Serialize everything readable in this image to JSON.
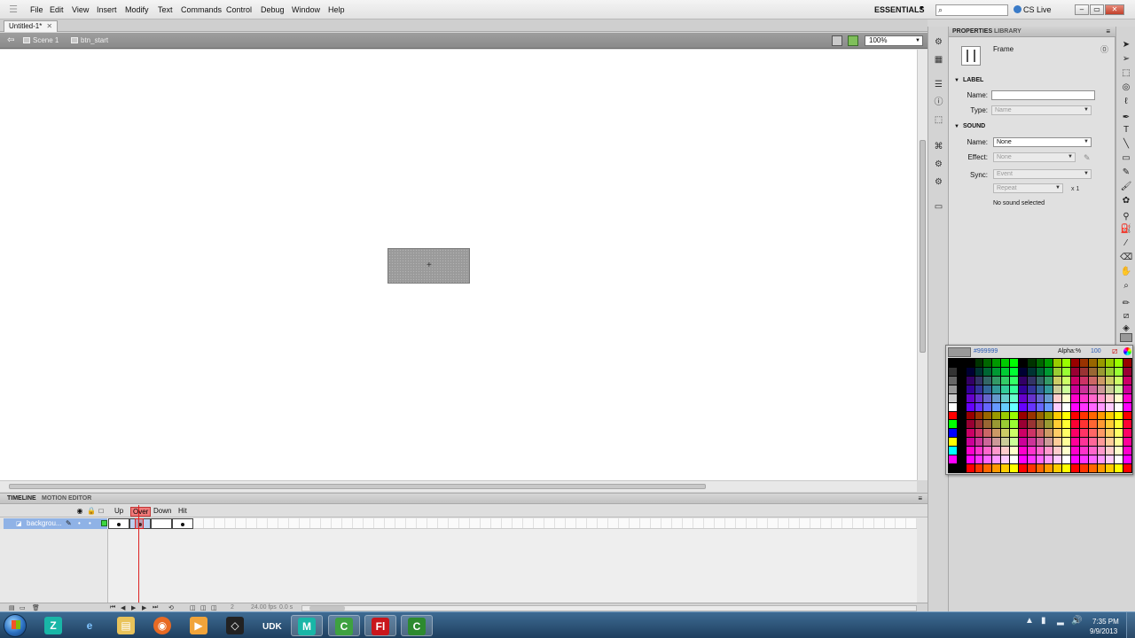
{
  "menu": {
    "items": [
      "File",
      "Edit",
      "View",
      "Insert",
      "Modify",
      "Text",
      "Commands",
      "Control",
      "Debug",
      "Window",
      "Help"
    ],
    "workspace": "ESSENTIALS",
    "cslive": "CS Live"
  },
  "document": {
    "tab": "Untitled-1*",
    "scene": "Scene 1",
    "symbol": "btn_start",
    "zoom": "100%"
  },
  "timeline": {
    "tabs": [
      "TIMELINE",
      "MOTION EDITOR"
    ],
    "states": [
      "Up",
      "Over",
      "Down",
      "Hit"
    ],
    "layer_name": "backgrou...",
    "fps": "24.00 fps",
    "time": "0.0 s",
    "frame_number": "2"
  },
  "properties": {
    "tabs": [
      "PROPERTIES",
      "LIBRARY"
    ],
    "type": "Frame",
    "label_section": "LABEL",
    "sound_section": "SOUND",
    "name_label": "Name:",
    "type_label": "Type:",
    "label_type_value": "Name",
    "sound_name_value": "None",
    "effect_label": "Effect:",
    "effect_value": "None",
    "sync_label": "Sync:",
    "sync_value": "Event",
    "repeat_value": "Repeat",
    "repeat_times": "x 1",
    "status": "No sound selected"
  },
  "swatches": {
    "hex": "#999999",
    "alpha_label": "Alpha:%",
    "alpha_value": "100"
  },
  "clock": {
    "time": "7:35 PM",
    "date": "9/9/2013"
  },
  "taskbar": {
    "apps": [
      "zbrush",
      "internet-explorer",
      "file-explorer",
      "firefox",
      "media-player",
      "unity",
      "udk",
      "maya",
      "camtasia",
      "flash",
      "camtasia-recorder"
    ]
  },
  "colors": {
    "fill": "#999999",
    "accent_blue": "#8fb2e6",
    "over_state": "#f07a7a",
    "playhead": "#dd2222"
  }
}
